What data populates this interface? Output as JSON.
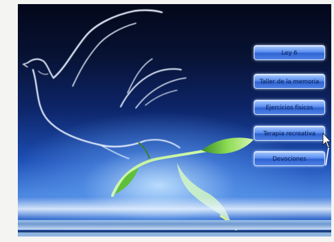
{
  "menu": {
    "items": [
      {
        "label": "Ley 6"
      },
      {
        "label": "Taller de la memoria"
      },
      {
        "label": "Ejercicios físicos"
      },
      {
        "label": "Terapia recreativa"
      },
      {
        "label": "Devociones"
      }
    ]
  },
  "colors": {
    "background_top": "#03071a",
    "background_bottom": "#4b86e0",
    "button_fill": "#5b8ff0",
    "button_text": "#0b1b44",
    "dove_outline": "#e9f1ff",
    "leaf_green": "#7fd24a"
  },
  "icons": {
    "artwork": "dove-with-olive-branch-icon",
    "pointer": "mouse-pointer-icon"
  }
}
